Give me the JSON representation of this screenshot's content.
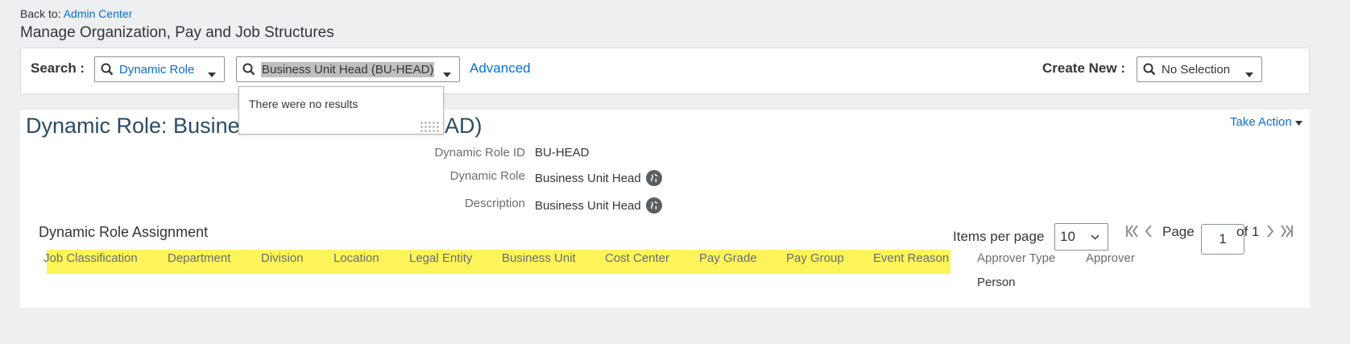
{
  "header": {
    "back_prefix": "Back to:",
    "back_link": "Admin Center",
    "title": "Manage Organization, Pay and Job Structures"
  },
  "search": {
    "label": "Search :",
    "type_value": "Dynamic Role",
    "query_value": "Business Unit Head (BU-HEAD)",
    "advanced_label": "Advanced",
    "no_results": "There were no results"
  },
  "create": {
    "label": "Create New :",
    "value": "No Selection"
  },
  "record": {
    "title_left": "Dynamic Role: Busine",
    "title_right": "AD)",
    "take_action": "Take Action",
    "fields": [
      {
        "label": "Dynamic Role ID",
        "value": "BU-HEAD"
      },
      {
        "label": "Dynamic Role",
        "value": "Business Unit Head"
      },
      {
        "label": "Description",
        "value": "Business Unit Head"
      }
    ]
  },
  "assignment": {
    "title": "Dynamic Role Assignment",
    "columns": [
      "Job Classification",
      "Department",
      "Division",
      "Location",
      "Legal Entity",
      "Business Unit",
      "Cost Center",
      "Pay Grade",
      "Pay Group",
      "Event Reason",
      "Approver Type",
      "Approver"
    ],
    "rows": [
      {
        "approver_type": "Person"
      }
    ],
    "highlight_color": "#fdf45a"
  },
  "pager": {
    "items_label": "Items per page",
    "items_value": "10",
    "page_label": "Page",
    "page_value": "1",
    "of_label": "of 1"
  },
  "colors": {
    "link": "#0a6ed1",
    "title": "#2b4b63",
    "background": "#edeff0"
  },
  "icons": [
    "search-icon",
    "caret-down-icon",
    "globe-icon",
    "first-page-icon",
    "prev-page-icon",
    "next-page-icon",
    "last-page-icon",
    "chevron-down-icon"
  ]
}
